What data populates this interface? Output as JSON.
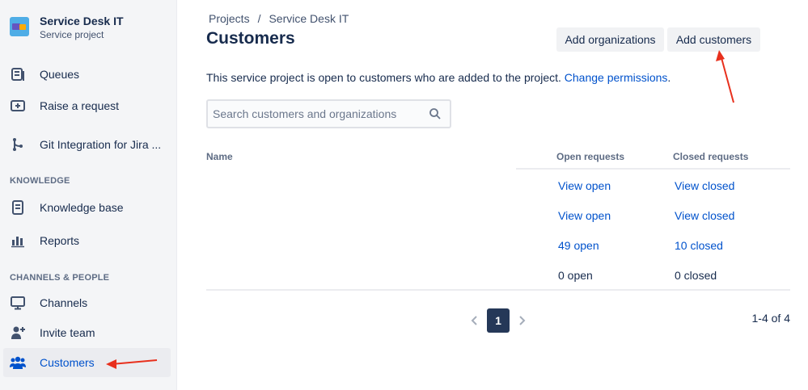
{
  "sidebar": {
    "project": {
      "name": "Service Desk IT",
      "type": "Service project"
    },
    "items_top": [
      {
        "label": "Queues",
        "icon": "queues-icon"
      },
      {
        "label": "Raise a request",
        "icon": "raise-request-icon"
      },
      {
        "label": "Git Integration for Jira ...",
        "icon": "git-branch-icon"
      }
    ],
    "knowledge_heading": "KNOWLEDGE",
    "items_knowledge": [
      {
        "label": "Knowledge base",
        "icon": "knowledge-base-icon"
      },
      {
        "label": "Reports",
        "icon": "reports-icon"
      }
    ],
    "channels_heading": "CHANNELS & PEOPLE",
    "items_channels": [
      {
        "label": "Channels",
        "icon": "monitor-icon"
      },
      {
        "label": "Invite team",
        "icon": "invite-user-icon"
      },
      {
        "label": "Customers",
        "icon": "customers-icon",
        "active": true
      }
    ]
  },
  "breadcrumb": {
    "root": "Projects",
    "separator": "/",
    "current": "Service Desk IT"
  },
  "page": {
    "title": "Customers",
    "add_organizations_label": "Add organizations",
    "add_customers_label": "Add customers",
    "info_text": "This service project is open to customers who are added to the project.",
    "info_link": "Change permissions",
    "info_suffix": "."
  },
  "search": {
    "placeholder": "Search customers and organizations"
  },
  "table": {
    "columns": [
      "Name",
      "Open requests",
      "Closed requests"
    ],
    "rows": [
      {
        "name": "",
        "open": "View open",
        "closed": "View closed"
      },
      {
        "name": "",
        "open": "View open",
        "closed": "View closed"
      },
      {
        "name": "",
        "open": "49 open",
        "closed": "10 closed"
      },
      {
        "name": "",
        "open": "0 open",
        "closed": "0 closed"
      }
    ]
  },
  "pagination": {
    "current_page": "1",
    "range": "1-4 of 4"
  },
  "colors": {
    "accent": "#0052cc",
    "sidebar_bg": "#f4f5f7",
    "annotation_arrow": "#e8301d"
  }
}
